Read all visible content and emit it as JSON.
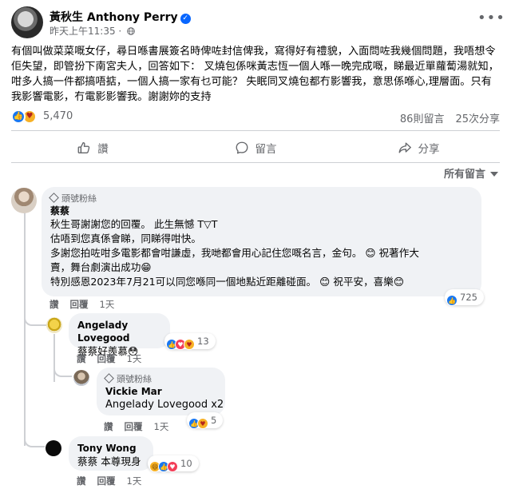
{
  "post": {
    "author": "黃秋生 Anthony Perry",
    "timestamp": "昨天上午11:35",
    "body": "有個叫做菜菜嘅女仔，尋日喺書展簽名時俾咗封信俾我，寫得好有禮貌，入面問咗我幾個問題，我唔想令佢失望，即管扮下南宮夫人，回答如下： 叉燒包係咪黃志恆一個人喺一晚完成嘅，睇最近單蘿蔔湯就知，咁多人搞一件都搞唔掂，一個人搞一家有乜可能？ 失眠同叉燒包都冇影響我，意思係喺心,理層面。只有我影響電影，冇電影影響我。謝謝妳的支持",
    "reaction_count": "5,470",
    "comments_count": "86則留言",
    "shares_count": "25次分享",
    "icons": {
      "verified": "verified-badge-icon",
      "privacy": "globe-icon",
      "more": "more-options-icon"
    }
  },
  "actions": {
    "like": "讚",
    "comment": "留言",
    "share": "分享"
  },
  "sort_label": "所有留言",
  "comments": [
    {
      "badge": "頭號粉絲",
      "name": "蔡蔡",
      "lines": [
        "秋生哥謝謝您的回覆。 此生無憾 T▽T",
        "估唔到您真係會睇，同睇得咁快。",
        "多謝您拍咗咁多電影都會咁謙虛，我哋都會用心記住您嘅名言，金句。 😊 祝著作大",
        "賣，舞台劇演出成功😁",
        "特別感恩2023年7月21可以同您喺同一個地點近距離碰面。 😊 祝平安，喜樂😊"
      ],
      "like_label": "讚",
      "reply_label": "回覆",
      "time": "1天",
      "reaction_count": "725"
    },
    {
      "name": "Angelady Lovegood",
      "text": "蔡蔡好羨慕😳",
      "like_label": "讚",
      "reply_label": "回覆",
      "time": "1天",
      "reaction_count": "13"
    },
    {
      "badge": "頭號粉絲",
      "name": "Vickie Mar",
      "text": "Angelady Lovegood x2",
      "like_label": "讚",
      "reply_label": "回覆",
      "time": "1天",
      "reaction_count": "5"
    },
    {
      "name": "Tony Wong",
      "text": "蔡蔡 本尊現身",
      "like_label": "讚",
      "reply_label": "回覆",
      "time": "1天",
      "reaction_count": "10"
    }
  ],
  "colors": {
    "accent": "#0866ff",
    "like": "#1877f2",
    "love": "#f33e58",
    "haha": "#f7b125",
    "muted": "#65676b",
    "bubble": "#f0f2f5"
  }
}
